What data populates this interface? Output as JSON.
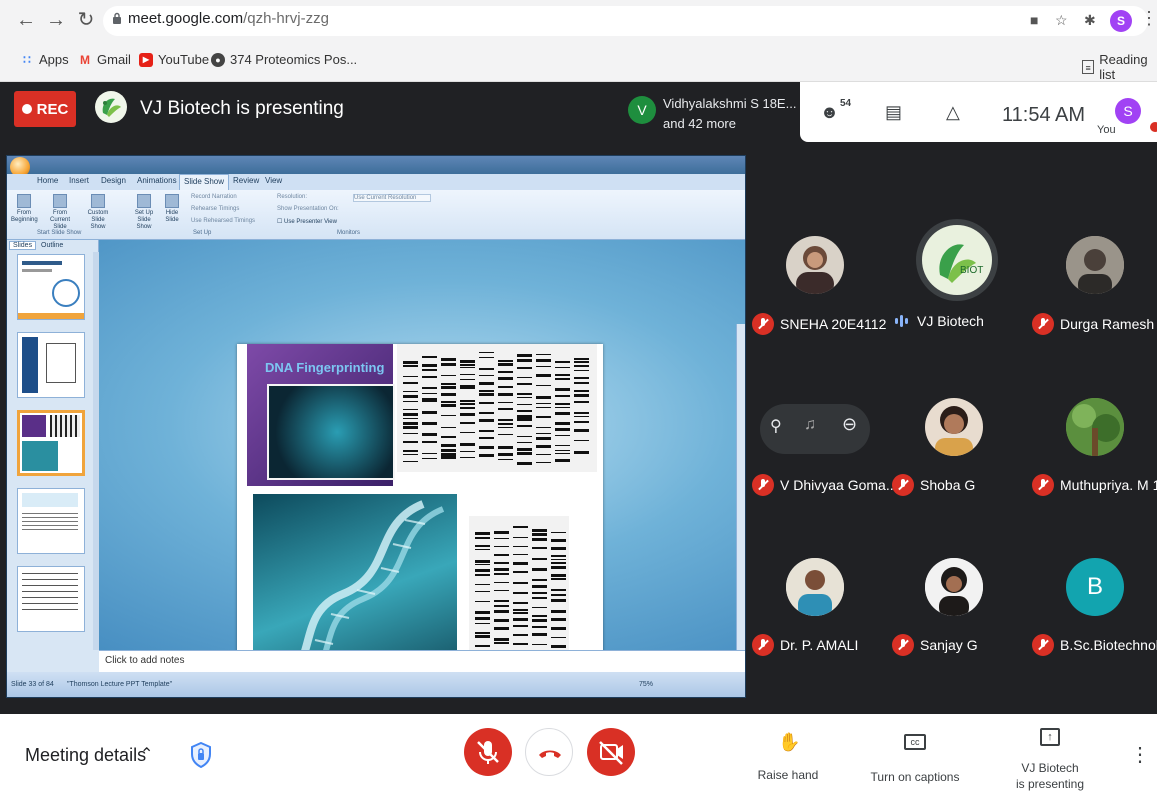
{
  "browser": {
    "url_domain": "meet.google.com",
    "url_path": "/qzh-hrvj-zzg",
    "profile_initial": "S",
    "bookmarks": [
      {
        "icon": "apps-grid-icon",
        "label": "Apps"
      },
      {
        "icon": "gmail-icon",
        "label": "Gmail"
      },
      {
        "icon": "youtube-icon",
        "label": "YouTube"
      },
      {
        "icon": "globe-icon",
        "label": "374 Proteomics Pos..."
      }
    ],
    "reading_list": "Reading list"
  },
  "meet": {
    "rec_label": "REC",
    "presenting_title": "VJ Biotech is presenting",
    "spotlight": {
      "initial": "V",
      "name": "Vidhyalakshmi S 18E...",
      "more": "and 42 more"
    },
    "participant_count": "54",
    "clock": "11:54 AM",
    "you_initial": "S",
    "you_label": "You",
    "logo_text": "BIOT",
    "presentation": {
      "tabs": [
        "Home",
        "Insert",
        "Design",
        "Animations",
        "Slide Show",
        "Review",
        "View"
      ],
      "active_tab": "Slide Show",
      "ribbon_buttons": [
        "From Beginning",
        "From Current Slide",
        "Custom Slide Show",
        "Set Up Slide Show",
        "Hide Slide"
      ],
      "ribbon_small": [
        "Record Narration",
        "Rehearse Timings",
        "Use Rehearsed Timings",
        "Resolution:",
        "Use Current Resolution",
        "Show Presentation On:"
      ],
      "presenter_view": "Use Presenter View",
      "groups": [
        "Start Slide Show",
        "Set Up",
        "Monitors"
      ],
      "panel_tabs": [
        "Slides",
        "Outline"
      ],
      "slide_title": "DNA Fingerprinting",
      "notes_placeholder": "Click to add notes",
      "status_slide": "Slide 33 of 84",
      "status_theme": "\"Thomson Lecture PPT Template\"",
      "zoom": "75%"
    },
    "participants": [
      {
        "name": "SNEHA 20E4112",
        "muted": true
      },
      {
        "name": "VJ Biotech",
        "muted": false
      },
      {
        "name": "Durga Ramesh",
        "muted": true
      },
      {
        "name": "V Dhivyaa Goma...",
        "muted": true
      },
      {
        "name": "Shoba G",
        "muted": true
      },
      {
        "name": "Muthupriya. M 1...",
        "muted": true
      },
      {
        "name": "Dr. P. AMALI",
        "muted": true
      },
      {
        "name": "Sanjay G",
        "muted": true
      },
      {
        "name": "B.Sc.Biotechnol...",
        "muted": true,
        "initial": "B"
      }
    ]
  },
  "controls": {
    "meeting_details": "Meeting details",
    "raise_hand": "Raise hand",
    "captions": "Turn on captions",
    "presenting_line1": "VJ Biotech",
    "presenting_line2": "is presenting"
  },
  "colors": {
    "red": "#d93025",
    "dark": "#202124",
    "teal_avatar": "#12a4af",
    "green_avatar": "#1e8e3e",
    "purple_avatar": "#a142f4"
  }
}
